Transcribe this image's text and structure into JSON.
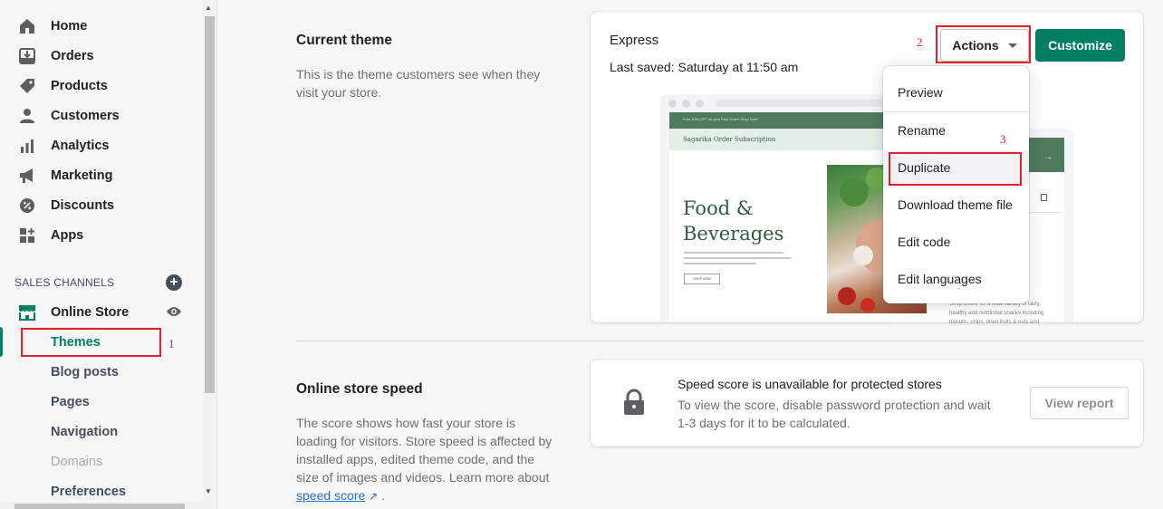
{
  "sidebar": {
    "items": [
      {
        "label": "Home",
        "icon": "home-icon"
      },
      {
        "label": "Orders",
        "icon": "orders-icon"
      },
      {
        "label": "Products",
        "icon": "tag-icon"
      },
      {
        "label": "Customers",
        "icon": "person-icon"
      },
      {
        "label": "Analytics",
        "icon": "bar-chart-icon"
      },
      {
        "label": "Marketing",
        "icon": "megaphone-icon"
      },
      {
        "label": "Discounts",
        "icon": "discount-icon"
      },
      {
        "label": "Apps",
        "icon": "apps-icon"
      }
    ],
    "sales_channels_title": "SALES CHANNELS",
    "online_store_label": "Online Store",
    "sub_items": [
      {
        "label": "Themes",
        "state": "active"
      },
      {
        "label": "Blog posts",
        "state": "normal"
      },
      {
        "label": "Pages",
        "state": "normal"
      },
      {
        "label": "Navigation",
        "state": "normal"
      },
      {
        "label": "Domains",
        "state": "disabled"
      },
      {
        "label": "Preferences",
        "state": "normal"
      }
    ]
  },
  "annotations": [
    "1",
    "2",
    "3"
  ],
  "current_theme": {
    "title": "Current theme",
    "description": "This is the theme customers see when they visit your store.",
    "theme_name": "Express",
    "last_saved": "Last saved: Saturday at 11:50 am",
    "actions_label": "Actions",
    "customize_label": "Customize",
    "menu": [
      "Preview",
      "Rename",
      "Duplicate",
      "Download theme file",
      "Edit code",
      "Edit languages"
    ],
    "preview": {
      "announcement": "Free 10% OFF on your First Order! Shop Now!",
      "brand": "Sagarika Order Subscription",
      "headline_line1": "Food &",
      "headline_line2": "Beverages",
      "shop_button": "SHOP NOW",
      "mobile_letter": "s",
      "mobile_text": "Shop online for a wide variety of tasty, healthy and nutritional snacks including biscuits, chips, dried fruits & nuts and"
    }
  },
  "speed": {
    "title": "Online store speed",
    "description_pre": "The score shows how fast your store is loading for visitors. Store speed is affected by installed apps, edited theme code, and the size of images and videos. Learn more about",
    "link_label": "speed score",
    "description_post": ".",
    "card_heading": "Speed score is unavailable for protected stores",
    "card_body": "To view the score, disable password protection and wait 1-3 days for it to be calculated.",
    "view_report_label": "View report"
  },
  "colors": {
    "accent": "#008060",
    "annotation": "#e0202a"
  }
}
